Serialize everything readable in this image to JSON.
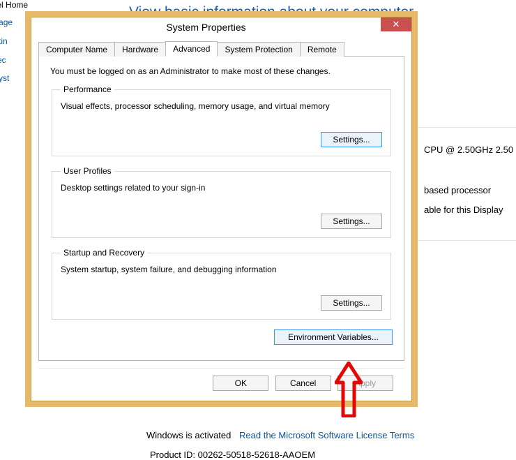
{
  "background": {
    "sidebar_home": "anel Home",
    "sidebar_items": [
      "lanage",
      "settin",
      "rotec",
      "d syst"
    ],
    "header": "View basic information about your computer",
    "cpu_line": "CPU @ 2.50GHz   2.50",
    "proc_line": "based processor",
    "disp_line": "able for this Display",
    "activation_label": "Windows is activated",
    "activation_link": "Read the Microsoft Software License Terms",
    "product_id_label": "Product ID: 00262-50518-52618-AAOEM"
  },
  "dialog": {
    "title": "System Properties",
    "close_glyph": "✕",
    "tabs": [
      {
        "label": "Computer Name"
      },
      {
        "label": "Hardware"
      },
      {
        "label": "Advanced",
        "active": true
      },
      {
        "label": "System Protection"
      },
      {
        "label": "Remote"
      }
    ],
    "admin_msg": "You must be logged on as an Administrator to make most of these changes.",
    "groups": {
      "performance": {
        "legend": "Performance",
        "desc": "Visual effects, processor scheduling, memory usage, and virtual memory",
        "button": "Settings..."
      },
      "user_profiles": {
        "legend": "User Profiles",
        "desc": "Desktop settings related to your sign-in",
        "button": "Settings..."
      },
      "startup": {
        "legend": "Startup and Recovery",
        "desc": "System startup, system failure, and debugging information",
        "button": "Settings..."
      }
    },
    "env_button": "Environment Variables...",
    "buttons": {
      "ok": "OK",
      "cancel": "Cancel",
      "apply": "Apply"
    }
  }
}
